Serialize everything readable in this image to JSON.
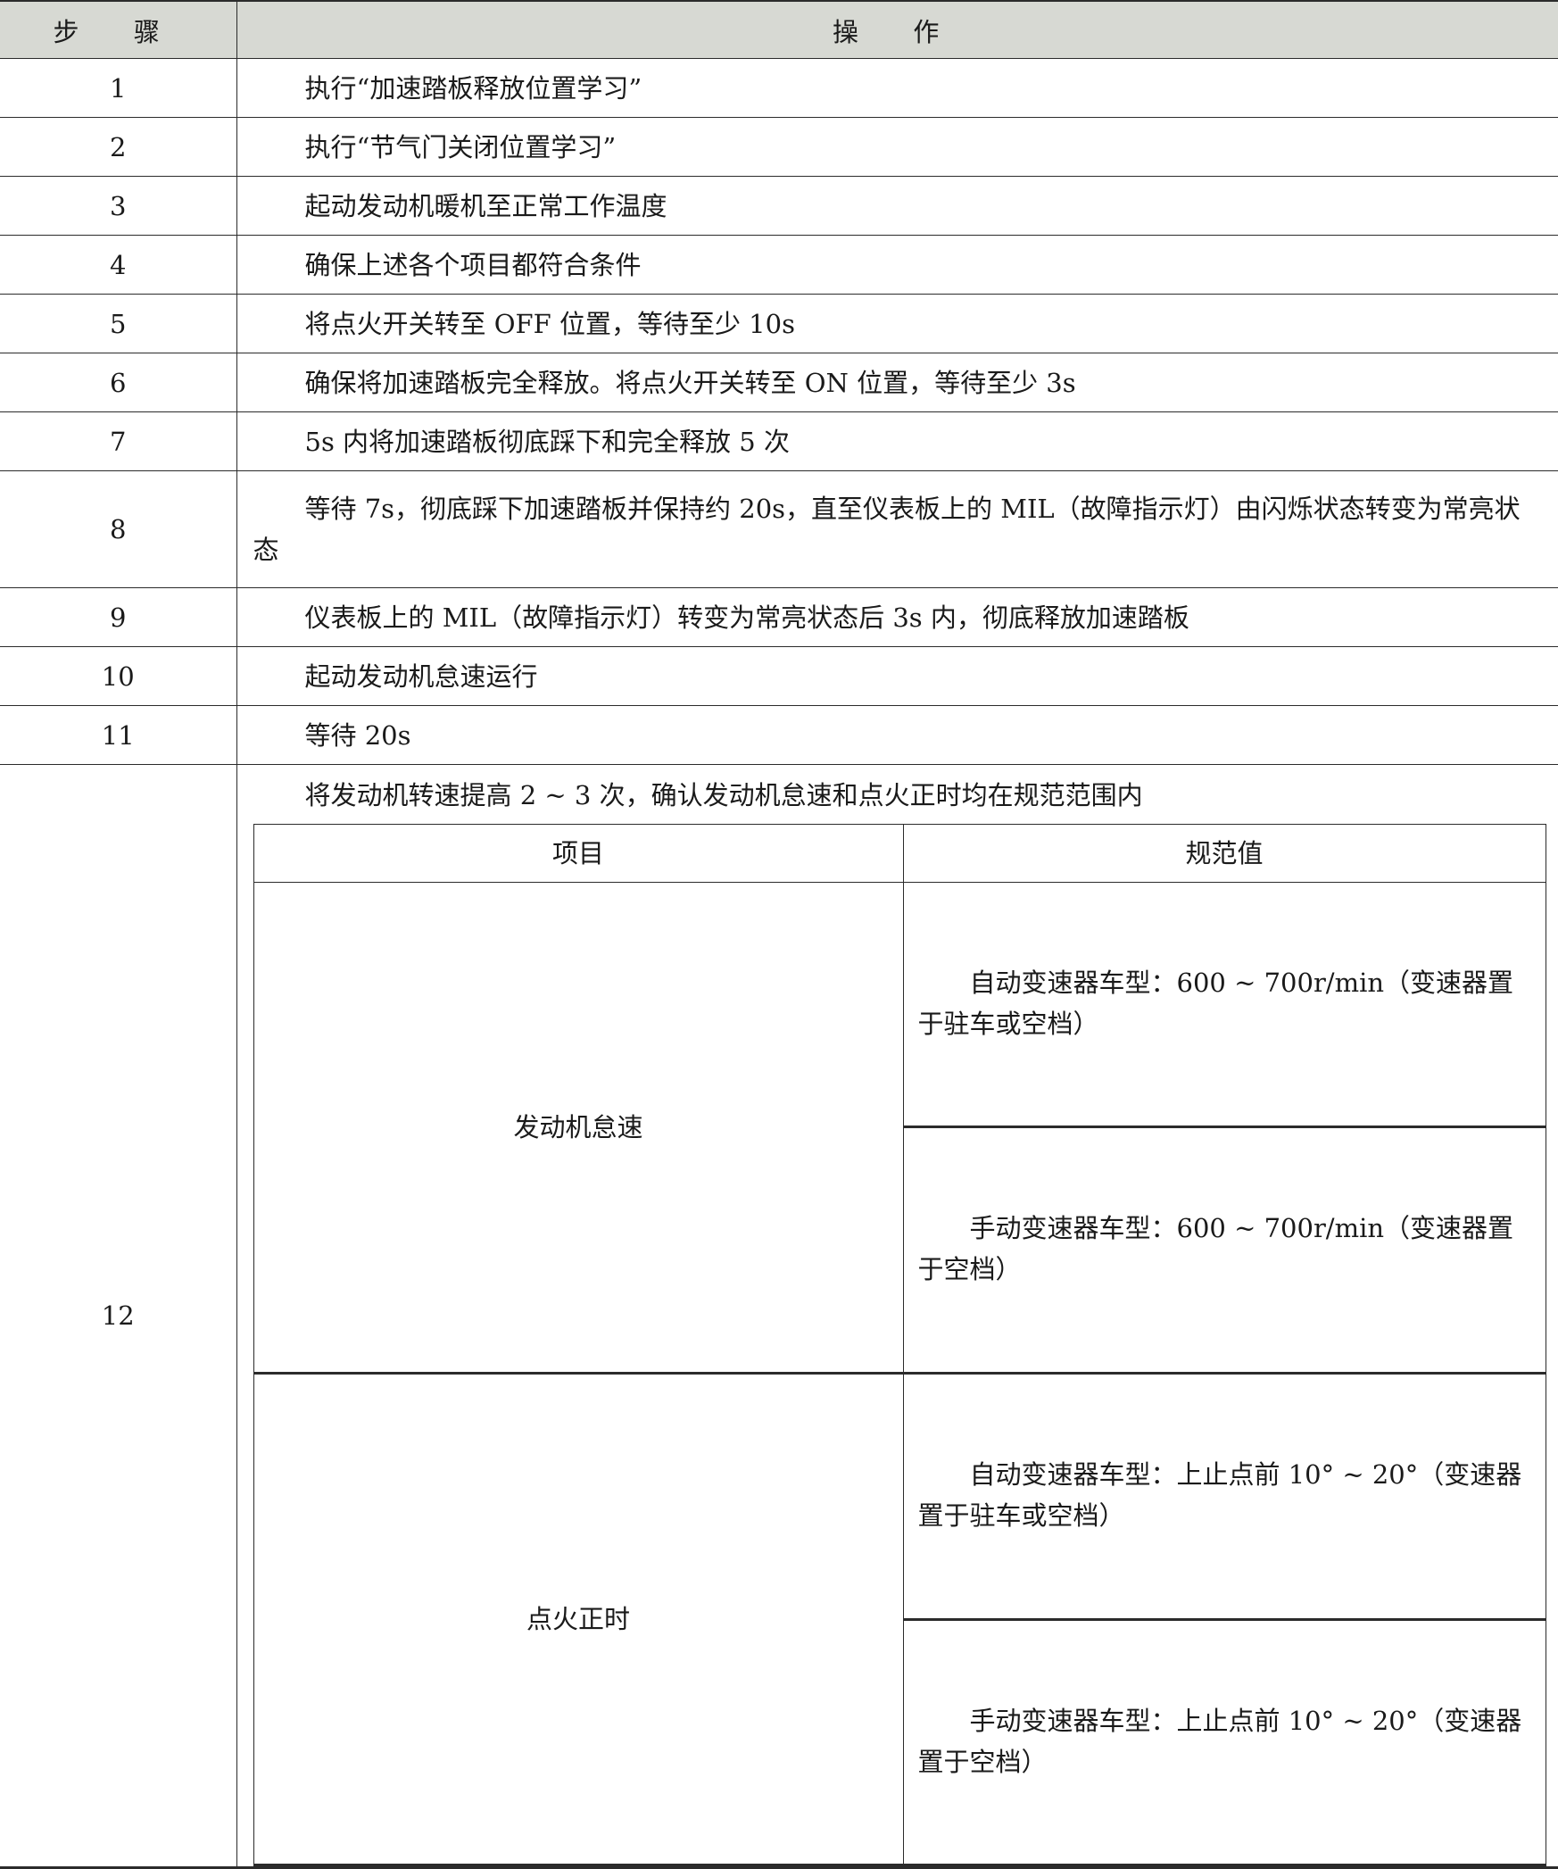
{
  "header": {
    "step": "步 骤",
    "operation": "操 作"
  },
  "rows": [
    {
      "step": "1",
      "text": "执行“加速踏板释放位置学习”"
    },
    {
      "step": "2",
      "text": "执行“节气门关闭位置学习”"
    },
    {
      "step": "3",
      "text": "起动发动机暖机至正常工作温度"
    },
    {
      "step": "4",
      "text": "确保上述各个项目都符合条件"
    },
    {
      "step": "5",
      "text": "将点火开关转至 OFF 位置，等待至少 10s"
    },
    {
      "step": "6",
      "text": "确保将加速踏板完全释放。将点火开关转至 ON 位置，等待至少 3s"
    },
    {
      "step": "7",
      "text": "5s 内将加速踏板彻底踩下和完全释放 5 次"
    },
    {
      "step": "8",
      "text": "等待 7s，彻底踩下加速踏板并保持约 20s，直至仪表板上的 MIL（故障指示灯）由闪烁状态转变为常亮状态"
    },
    {
      "step": "9",
      "text": "仪表板上的 MIL（故障指示灯）转变为常亮状态后 3s 内，彻底释放加速踏板"
    },
    {
      "step": "10",
      "text": "起动发动机怠速运行"
    },
    {
      "step": "11",
      "text": "等待 20s"
    }
  ],
  "step12": {
    "step": "12",
    "intro": "将发动机转速提高 2 ~ 3 次，确认发动机怠速和点火正时均在规范范围内",
    "inner_header": {
      "item": "项目",
      "spec": "规范值"
    },
    "items": [
      {
        "name": "发动机怠速",
        "specs": [
          "自动变速器车型：600 ~ 700r/min（变速器置于驻车或空档）",
          "手动变速器车型：600 ~ 700r/min（变速器置于空档）"
        ]
      },
      {
        "name": "点火正时",
        "specs": [
          "自动变速器车型：上止点前 10° ~ 20°（变速器置于驻车或空档）",
          "手动变速器车型：上止点前 10° ~ 20°（变速器置于空档）"
        ]
      }
    ]
  }
}
